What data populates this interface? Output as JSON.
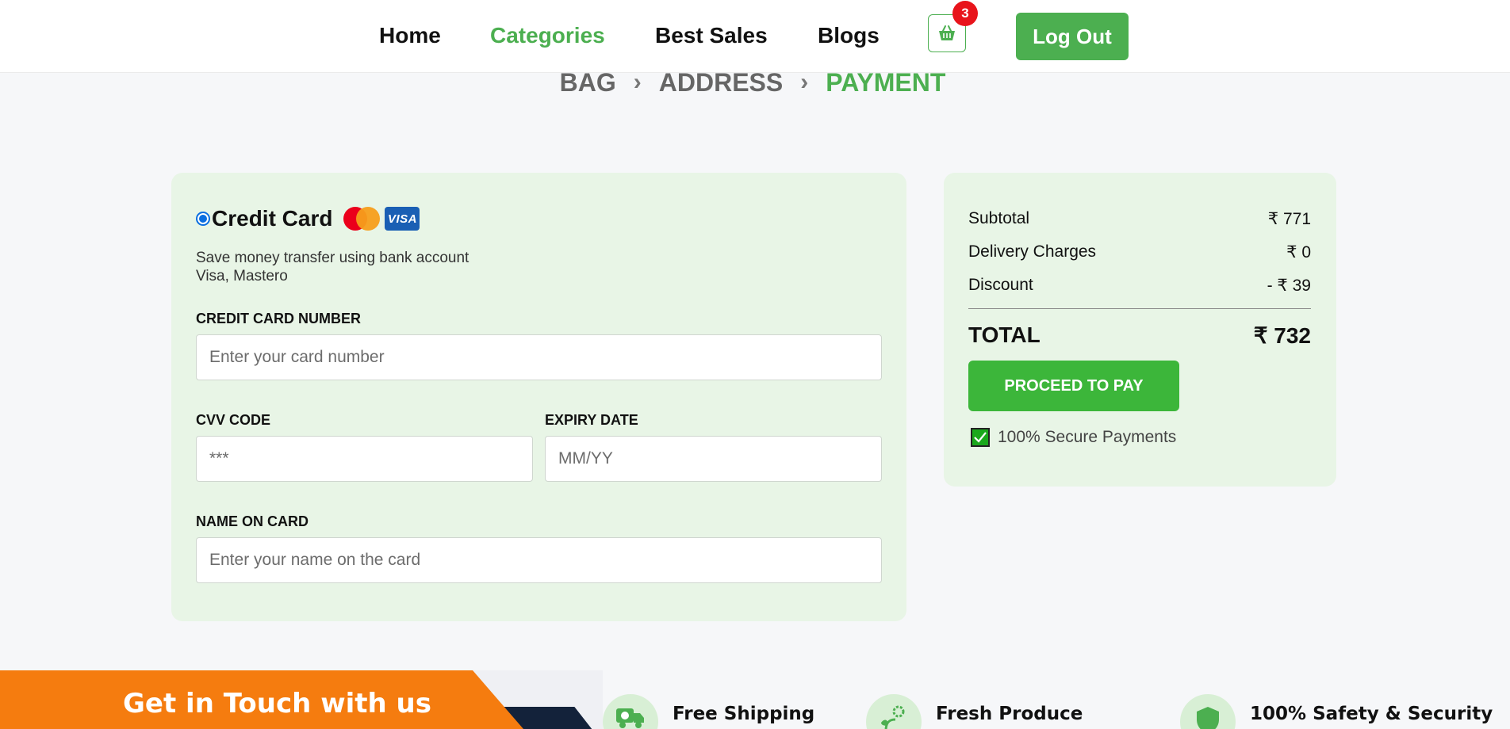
{
  "navbar": {
    "links": [
      {
        "label": "Home",
        "active": false
      },
      {
        "label": "Categories",
        "active": true
      },
      {
        "label": "Best Sales",
        "active": false
      },
      {
        "label": "Blogs",
        "active": false
      }
    ],
    "cart": {
      "icon": "basket-icon",
      "count": "3"
    },
    "logout_label": "Log Out"
  },
  "steps": {
    "items": [
      "BAG",
      "ADDRESS",
      "PAYMENT"
    ],
    "separator": "›",
    "current": "PAYMENT"
  },
  "payment": {
    "method_label": "Credit Card",
    "selected": true,
    "card_brands": [
      "mastercard-icon",
      "visa-icon"
    ],
    "visa_text": "VISA",
    "description_line1": "Save money transfer using bank account",
    "description_line2": "Visa, Mastero",
    "card_number": {
      "label": "CREDIT CARD NUMBER",
      "placeholder": "Enter your card number",
      "value": ""
    },
    "cvv": {
      "label": "CVV CODE",
      "placeholder": "***",
      "value": ""
    },
    "expiry": {
      "label": "EXPIRY DATE",
      "placeholder": "MM/YY",
      "value": ""
    },
    "name": {
      "label": "NAME ON CARD",
      "placeholder": "Enter your name on the card",
      "value": ""
    }
  },
  "summary": {
    "subtotal_label": "Subtotal",
    "subtotal_value": "₹ 771",
    "delivery_label": "Delivery Charges",
    "delivery_value": "₹ 0",
    "discount_label": "Discount",
    "discount_value": "- ₹ 39",
    "total_label": "TOTAL",
    "total_value": "₹ 732",
    "proceed_label": "PROCEED TO PAY",
    "secure_label": "100% Secure Payments"
  },
  "footer": {
    "touch_title": "Get in Touch with us",
    "features": [
      {
        "title": "Free Shipping",
        "icon": "delivery-truck-icon"
      },
      {
        "title": "Fresh Produce",
        "icon": "leaf-icon"
      },
      {
        "title": "100% Safety & Security",
        "icon": "shield-icon"
      }
    ]
  },
  "colors": {
    "accent": "#4caf50",
    "proceed": "#3cb63a",
    "panel": "#e8f5e6",
    "badge": "#e8141b",
    "orange": "#f57c0f",
    "navy": "#13223a"
  }
}
